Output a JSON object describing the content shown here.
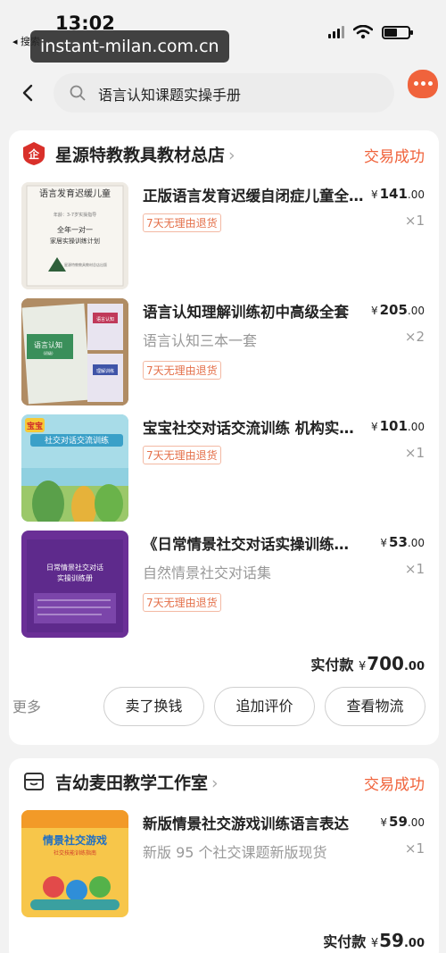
{
  "status_bar": {
    "time": "13:02",
    "back_app": "◂ 搜索"
  },
  "watermark": "instant-milan.com.cn",
  "search": {
    "query": "语言认知课题实操手册"
  },
  "orders": [
    {
      "shop_name": "星源特教教具教材总店",
      "status": "交易成功",
      "items": [
        {
          "title": "正版语言发育迟缓自闭症儿童全年一对一家居实操训练计划",
          "price_int": "141",
          "price_dec": ".00",
          "quantity": "×1",
          "spec": "",
          "tag": "7天无理由退货",
          "thumb_texts": [
            "语言发育迟缓儿童",
            "年龄：3-7岁实操指导",
            "全年一对一",
            "家居实操训练计划",
            "星源特教教具教材总店出版"
          ]
        },
        {
          "title": "语言认知理解训练初中高级全套",
          "price_int": "205",
          "price_dec": ".00",
          "quantity": "×2",
          "spec": "语言认知三本一套",
          "tag": "7天无理由退货",
          "thumb_texts": [
            "语言认知",
            "(初级)",
            "语言认知",
            "理解训练"
          ]
        },
        {
          "title": "宝宝社交对话交流训练 机构实操指导",
          "price_int": "101",
          "price_dec": ".00",
          "quantity": "×1",
          "spec": "",
          "tag": "7天无理由退货",
          "thumb_texts": [
            "宝宝",
            "社交对话交流训练"
          ]
        },
        {
          "title": "《日常情景社交对话实操训练册》",
          "price_int": "53",
          "price_dec": ".00",
          "quantity": "×1",
          "spec": "自然情景社交对话集",
          "tag": "7天无理由退货",
          "thumb_texts": [
            "日常情景社交对话",
            "实操训练册"
          ]
        }
      ],
      "paid_label": "实付款",
      "paid_int": "700",
      "paid_dec": ".00",
      "actions": {
        "more": "更多",
        "sell": "卖了换钱",
        "review": "追加评价",
        "logistics": "查看物流"
      }
    },
    {
      "shop_name": "吉幼麦田教学工作室",
      "status": "交易成功",
      "items": [
        {
          "title": "新版情景社交游戏训练语言表达",
          "price_int": "59",
          "price_dec": ".00",
          "quantity": "×1",
          "spec": "新版 95 个社交课题新版现货",
          "tag": "",
          "thumb_texts": [
            "情景社交游戏",
            "社交技能训练指南"
          ]
        }
      ],
      "paid_label": "实付款",
      "paid_int": "59",
      "paid_dec": ".00"
    }
  ],
  "currency": "¥",
  "colors": {
    "accent": "#f0623a",
    "shop_badge_red": "#d9302a"
  }
}
